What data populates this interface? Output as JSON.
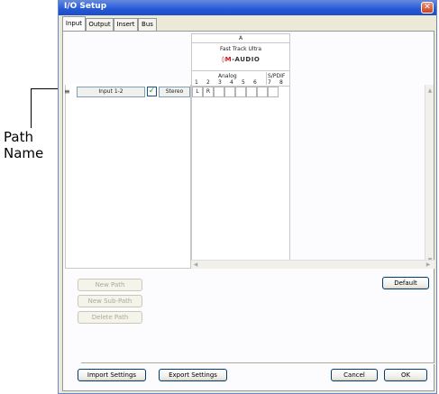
{
  "callout": {
    "line1": "Path",
    "line2": "Name"
  },
  "window": {
    "title": "I/O Setup",
    "close_glyph": "✕"
  },
  "tabs": [
    {
      "label": "Input"
    },
    {
      "label": "Output"
    },
    {
      "label": "Insert"
    },
    {
      "label": "Bus"
    }
  ],
  "grid": {
    "header_number": "A",
    "device_name": "Fast Track Ultra",
    "brand_mark": "◊M",
    "brand_text": "-AUDIO",
    "group_analog": "Analog",
    "group_spdif": "S/PDIF",
    "channels": [
      "1",
      "2",
      "3",
      "4",
      "5",
      "6",
      "7",
      "8"
    ]
  },
  "path_row": {
    "handle": "≡",
    "name": "Input 1-2",
    "checked": "✓",
    "format": "Stereo",
    "assign_l": "L",
    "assign_r": "R"
  },
  "buttons": {
    "new_path": "New Path",
    "new_sub_path": "New Sub-Path",
    "delete_path": "Delete Path",
    "default": "Default",
    "import_settings": "Import Settings",
    "export_settings": "Export Settings",
    "cancel": "Cancel",
    "ok": "OK"
  },
  "scroll_arrows": {
    "up": "▲",
    "down": "▼",
    "left": "◀",
    "right": "▶"
  }
}
